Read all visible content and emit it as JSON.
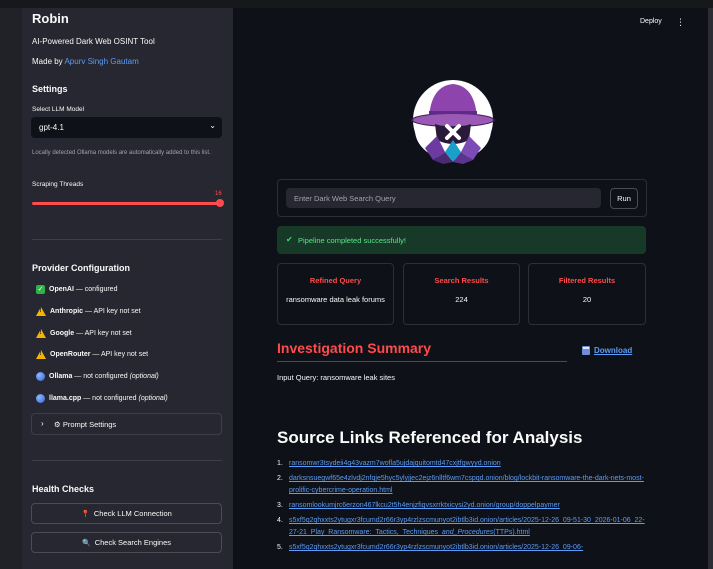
{
  "sidebar": {
    "title": "Robin",
    "subtitle": "AI-Powered Dark Web OSINT Tool",
    "made_by_prefix": "Made by",
    "made_by_author": "Apurv Singh Gautam",
    "settings_heading": "Settings",
    "llm_label": "Select LLM Model",
    "llm_value": "gpt-4.1",
    "ollama_note": "Locally detected Ollama models are automatically added to this list.",
    "threads_label": "Scraping Threads",
    "threads_value": "16",
    "threads_fraction": 1.0,
    "provider_heading": "Provider Configuration",
    "providers": [
      {
        "name": "OpenAI",
        "status": " — configured",
        "optional": "",
        "icon": "check-icon"
      },
      {
        "name": "Anthropic",
        "status": " — API key not set",
        "optional": "",
        "icon": "warning-icon"
      },
      {
        "name": "Google",
        "status": " — API key not set",
        "optional": "",
        "icon": "warning-icon"
      },
      {
        "name": "OpenRouter",
        "status": " — API key not set",
        "optional": "",
        "icon": "warning-icon"
      },
      {
        "name": "Ollama",
        "status": " — not configured ",
        "optional": "(optional)",
        "icon": "blue-dot-icon"
      },
      {
        "name": "llama.cpp",
        "status": " — not configured ",
        "optional": "(optional)",
        "icon": "blue-dot-icon"
      }
    ],
    "prompt_settings_label": "Prompt Settings",
    "health_heading": "Health Checks",
    "check_llm_label": "Check LLM Connection",
    "check_search_label": "Check Search Engines"
  },
  "header": {
    "deploy_label": "Deploy"
  },
  "main": {
    "search_placeholder": "Enter Dark Web Search Query",
    "run_label": "Run",
    "success_message": "Pipeline completed successfully!",
    "metrics": [
      {
        "title": "Refined Query",
        "value": "ransomware data leak forums"
      },
      {
        "title": "Search Results",
        "value": "224"
      },
      {
        "title": "Filtered Results",
        "value": "20"
      }
    ],
    "investigation_title": "Investigation Summary",
    "download_label": "Download",
    "input_query": "Input Query: ransomware leak sites",
    "sources_title": "Source Links Referenced for Analysis",
    "sources": [
      {
        "num": "1.",
        "text": "ransomwr3tsydeii4q43vazm7wofla5ujdajquitomtd47cxjtfgwyyd.onion",
        "em": ""
      },
      {
        "num": "2.",
        "text": "darksnsuegwf65e4zlvdj2nfqje5hyc5ylyjjec2ejz6nlltf6wm7cspqd.onion/blog/lockbit-ransomware-the-dark-nets-most-prolific-cybercrime-operation.html",
        "em": ""
      },
      {
        "num": "3.",
        "text": "ransomlookumjrc6erzon467lkcu2t5h4enjzfigvsxrrktxicysi2yd.onion/group/doppelpaymer",
        "em": ""
      },
      {
        "num": "4.",
        "text": "s5xf5q2qhxxts2ytugxr3fcumd2r66r3yp4rzlzscmunyot2ibtlb3id.onion/articles/2025-12-26_09-51-30_2026-01-06_22-27-21_Play_Ransomware:_Tactics,_Techniques_",
        "em": "and_Procedures",
        "tail": "(TTPs).html"
      },
      {
        "num": "5.",
        "text": "s5xf5q2qhxxts2ytugxr3fcumd2r66r3yp4rzlzscmunyot2ibtlb3id.onion/articles/2025-12-26_09-06-",
        "em": ""
      }
    ]
  }
}
